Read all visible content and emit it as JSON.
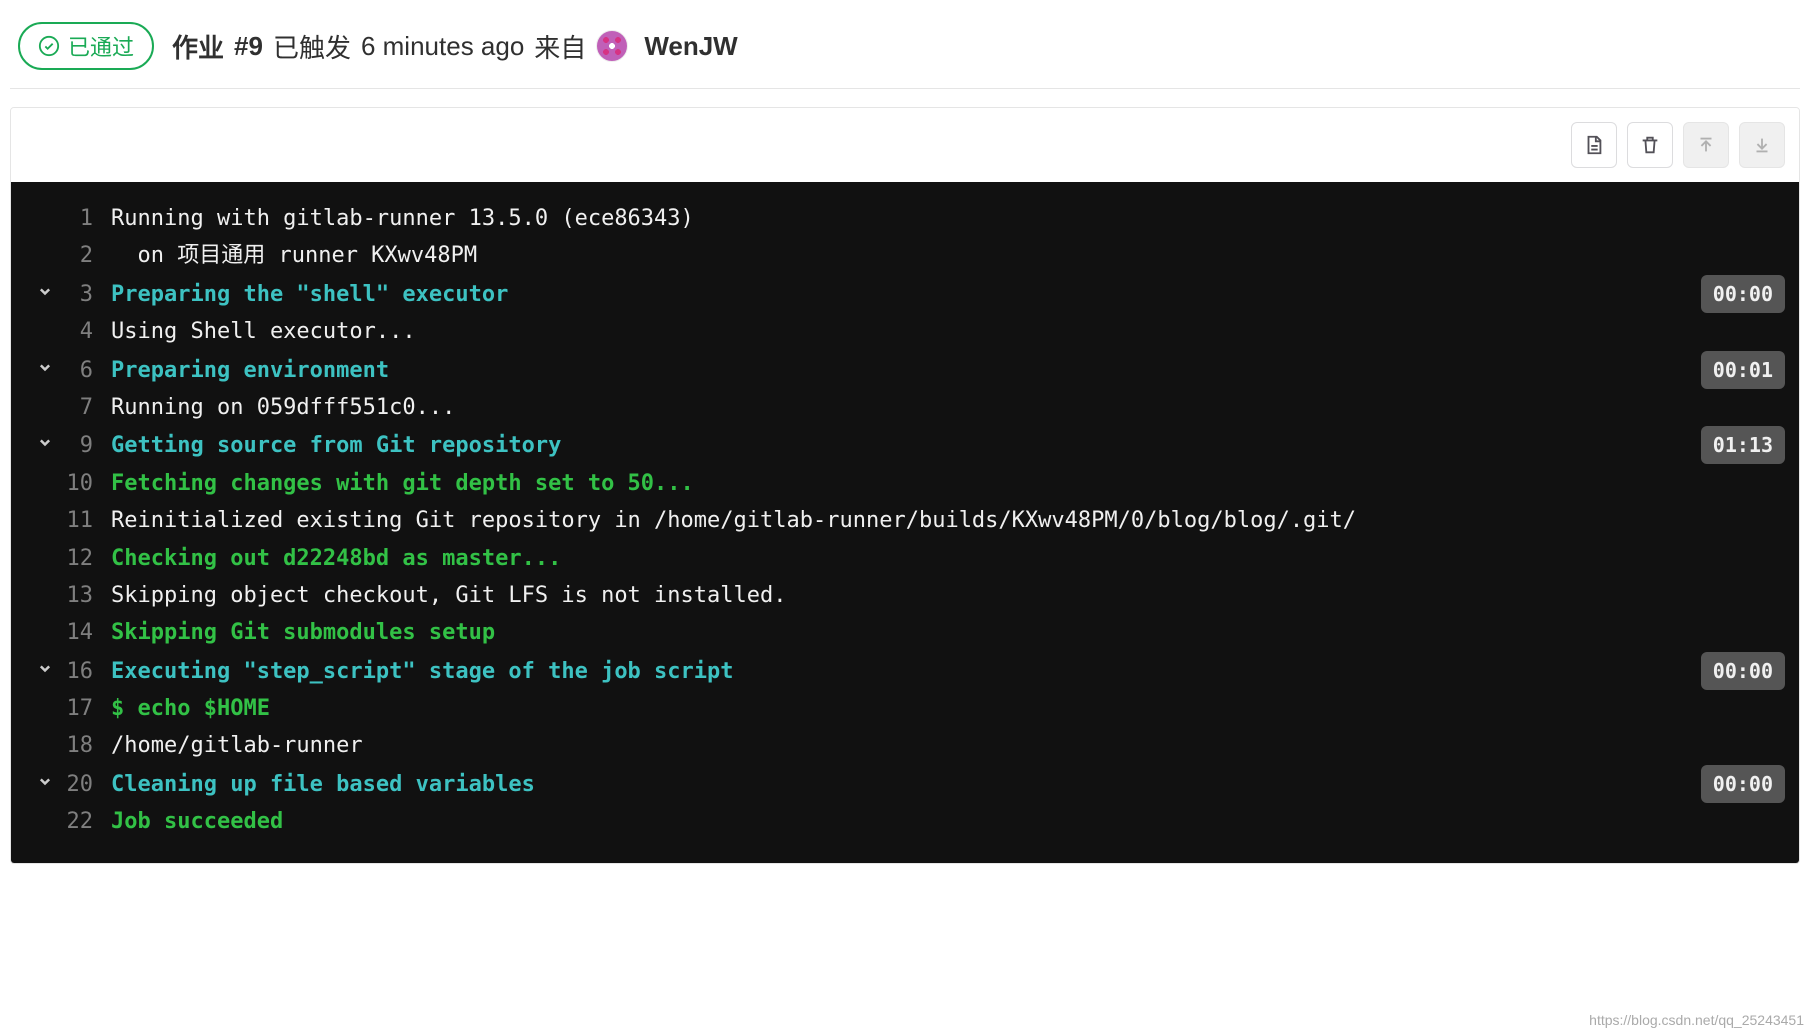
{
  "header": {
    "status_label": "已通过",
    "job_prefix": "作业",
    "job_number": "#9",
    "triggered_label": "已触发",
    "time_ago": "6 minutes ago",
    "from_label": "来自",
    "username": "WenJW"
  },
  "toolbar": {
    "raw_icon": "document-icon",
    "delete_icon": "trash-icon",
    "scroll_top_icon": "arrow-up-icon",
    "scroll_bottom_icon": "arrow-down-icon"
  },
  "log": [
    {
      "n": 1,
      "fold": false,
      "cls": "plain",
      "text": "Running with gitlab-runner 13.5.0 (ece86343)"
    },
    {
      "n": 2,
      "fold": false,
      "cls": "plain",
      "text": "  on 项目通用 runner KXwv48PM"
    },
    {
      "n": 3,
      "fold": true,
      "cls": "section",
      "text": "Preparing the \"shell\" executor",
      "duration": "00:00"
    },
    {
      "n": 4,
      "fold": false,
      "cls": "plain",
      "text": "Using Shell executor..."
    },
    {
      "n": 6,
      "fold": true,
      "cls": "section",
      "text": "Preparing environment",
      "duration": "00:01"
    },
    {
      "n": 7,
      "fold": false,
      "cls": "plain",
      "text": "Running on 059dfff551c0..."
    },
    {
      "n": 9,
      "fold": true,
      "cls": "section",
      "text": "Getting source from Git repository",
      "duration": "01:13"
    },
    {
      "n": 10,
      "fold": false,
      "cls": "green",
      "text": "Fetching changes with git depth set to 50..."
    },
    {
      "n": 11,
      "fold": false,
      "cls": "plain",
      "text": "Reinitialized existing Git repository in /home/gitlab-runner/builds/KXwv48PM/0/blog/blog/.git/"
    },
    {
      "n": 12,
      "fold": false,
      "cls": "green",
      "text": "Checking out d22248bd as master..."
    },
    {
      "n": 13,
      "fold": false,
      "cls": "plain",
      "text": "Skipping object checkout, Git LFS is not installed."
    },
    {
      "n": 14,
      "fold": false,
      "cls": "green",
      "text": "Skipping Git submodules setup"
    },
    {
      "n": 16,
      "fold": true,
      "cls": "section",
      "text": "Executing \"step_script\" stage of the job script",
      "duration": "00:00"
    },
    {
      "n": 17,
      "fold": false,
      "cls": "green",
      "text": "$ echo $HOME"
    },
    {
      "n": 18,
      "fold": false,
      "cls": "plain",
      "text": "/home/gitlab-runner"
    },
    {
      "n": 20,
      "fold": true,
      "cls": "section",
      "text": "Cleaning up file based variables",
      "duration": "00:00"
    },
    {
      "n": 22,
      "fold": false,
      "cls": "green",
      "text": "Job succeeded"
    }
  ],
  "watermark": "https://blog.csdn.net/qq_25243451"
}
